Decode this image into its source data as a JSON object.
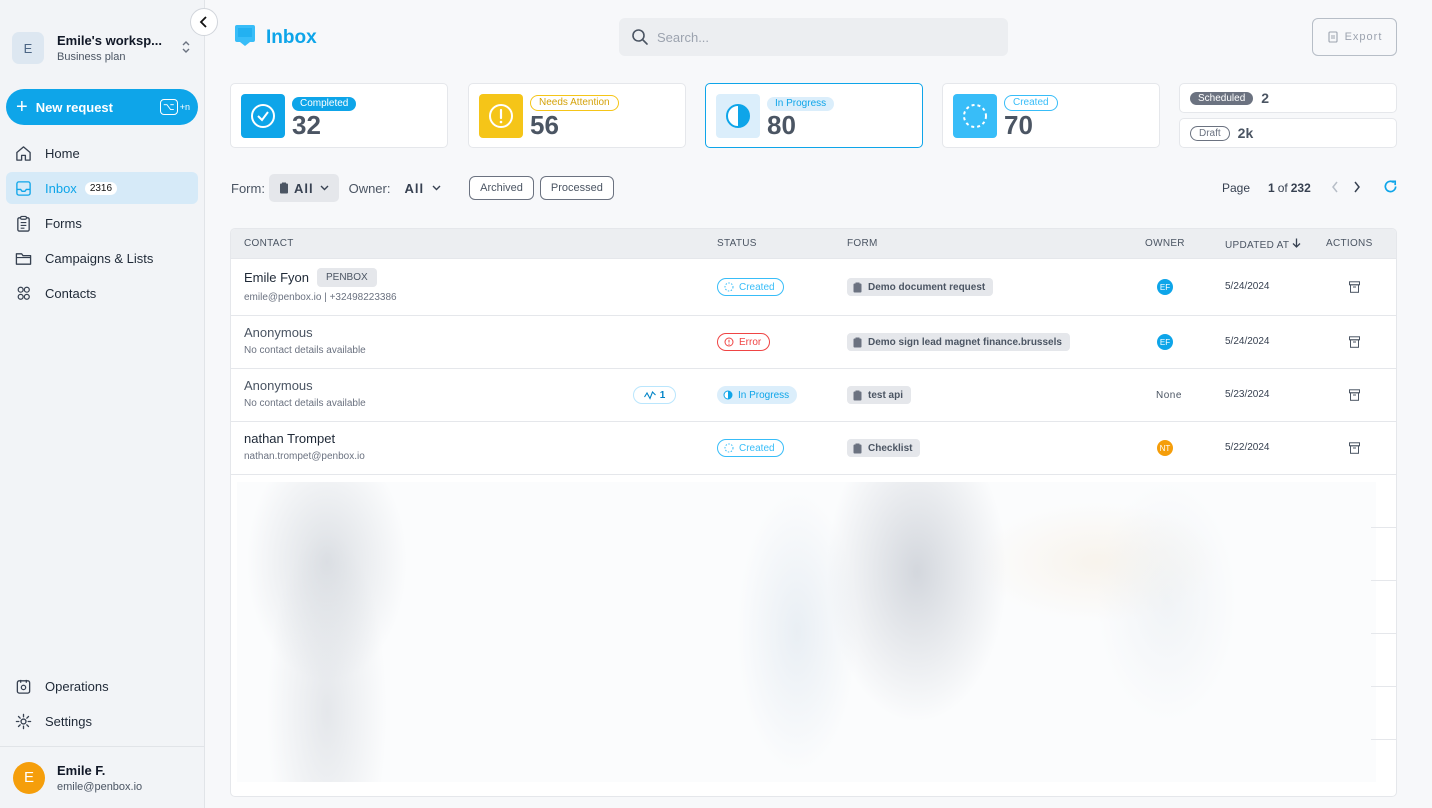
{
  "workspace": {
    "initial": "E",
    "name": "Emile's worksp...",
    "plan": "Business plan"
  },
  "new_request": {
    "label": "New request",
    "shortcut": "+n"
  },
  "nav": {
    "home": "Home",
    "inbox": "Inbox",
    "inbox_count": "2316",
    "forms": "Forms",
    "campaigns": "Campaigns & Lists",
    "contacts": "Contacts",
    "operations": "Operations",
    "settings": "Settings"
  },
  "user": {
    "initial": "E",
    "name": "Emile F.",
    "email": "emile@penbox.io"
  },
  "header": {
    "title": "Inbox",
    "search_placeholder": "Search...",
    "export_label": "Export"
  },
  "colors": {
    "accent": "#0ea5e9",
    "completed": "#0ea5e9",
    "attention": "#f5c518",
    "progress": "#38bdf8",
    "created": "#38bdf8",
    "error": "#ef4444",
    "owner_ef": "#0ea5e9",
    "owner_nt": "#f59e0b"
  },
  "stats": {
    "completed": {
      "label": "Completed",
      "value": "32"
    },
    "attention": {
      "label": "Needs Attention",
      "value": "56"
    },
    "progress": {
      "label": "In Progress",
      "value": "80"
    },
    "created": {
      "label": "Created",
      "value": "70"
    },
    "scheduled": {
      "label": "Scheduled",
      "value": "2"
    },
    "draft": {
      "label": "Draft",
      "value": "2k"
    }
  },
  "filters": {
    "form_label": "Form:",
    "form_value": "All",
    "owner_label": "Owner:",
    "owner_value": "All",
    "archived": "Archived",
    "processed": "Processed"
  },
  "pager": {
    "page_label": "Page",
    "current": "1",
    "of_label": "of",
    "total": "232"
  },
  "table": {
    "headers": {
      "contact": "CONTACT",
      "status": "STATUS",
      "form": "FORM",
      "owner": "OWNER",
      "updated": "UPDATED AT",
      "actions": "ACTIONS"
    },
    "rows": [
      {
        "name": "Emile Fyon",
        "tag": "PENBOX",
        "sub": "emile@penbox.io | +32498223386",
        "status": "Created",
        "form": "Demo document request",
        "owner": "EF",
        "date": "5/24/2024"
      },
      {
        "name": "Anonymous",
        "sub": "No contact details available",
        "status": "Error",
        "form": "Demo sign lead magnet finance.brussels",
        "owner": "EF",
        "date": "5/24/2024"
      },
      {
        "name": "Anonymous",
        "sub": "No contact details available",
        "activity": "1",
        "status": "In Progress",
        "form": "test api",
        "owner": "None",
        "date": "5/23/2024"
      },
      {
        "name": "nathan Trompet",
        "sub": "nathan.trompet@penbox.io",
        "status": "Created",
        "form": "Checklist",
        "owner": "NT",
        "date": "5/22/2024"
      }
    ]
  }
}
